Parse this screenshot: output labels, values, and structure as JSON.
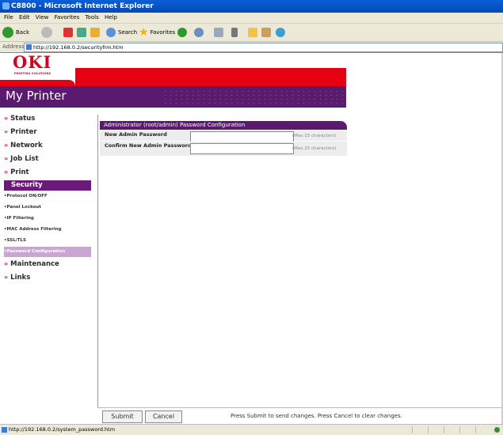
{
  "window": {
    "title": "C8800 - Microsoft Internet Explorer"
  },
  "menu": [
    "File",
    "Edit",
    "View",
    "Favorites",
    "Tools",
    "Help"
  ],
  "toolbar": {
    "back_label": "Back",
    "search_label": "Search",
    "favorites_label": "Favorites"
  },
  "address": {
    "label": "Address",
    "url": "http://192.168.0.2/securityfrm.htm"
  },
  "brand": {
    "logo": "OKI",
    "tagline": "PRINTING SOLUTIONS",
    "heading": "My Printer"
  },
  "nav": {
    "items": [
      "Status",
      "Printer",
      "Network",
      "Job List",
      "Print"
    ],
    "security": "Security",
    "sub": [
      "Protocol ON/OFF",
      "Panel Lockout",
      "IP Filtering",
      "MAC Address Filtering",
      "SSL/TLS",
      "Password Configuration"
    ],
    "after": [
      "Maintenance",
      "Links"
    ]
  },
  "form": {
    "title": "Administrator (root/admin) Password Configuration",
    "fields": [
      {
        "label": "New Admin Password",
        "value": "",
        "hint": "(Max.15 characters)"
      },
      {
        "label": "Confirm New Admin Password",
        "value": "",
        "hint": "(Max.15 characters)"
      }
    ]
  },
  "actions": {
    "submit": "Submit",
    "cancel": "Cancel",
    "message": "Press Submit to send changes. Press Cancel to clear changes."
  },
  "status": {
    "url": "http://192.168.0.2/system_password.htm"
  },
  "colors": {
    "accent_purple": "#5a1a6e",
    "brand_red": "#e50012",
    "active_sub": "#c9a6cf"
  }
}
